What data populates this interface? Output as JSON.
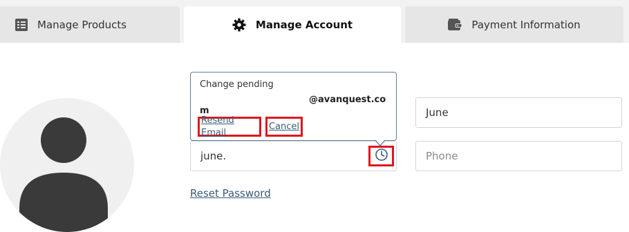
{
  "tabs": [
    {
      "label": "Manage Products",
      "icon": "list-icon",
      "active": false
    },
    {
      "label": "Manage Account",
      "icon": "gear-icon",
      "active": true
    },
    {
      "label": "Payment Information",
      "icon": "wallet-icon",
      "active": false
    }
  ],
  "popup": {
    "title": "Change pending",
    "email_line1": "@avanquest.co",
    "email_line2": "m",
    "resend_label": "Resend Email",
    "cancel_label": "Cancel"
  },
  "form": {
    "email_value": "june.",
    "first_name_value": "June",
    "phone_placeholder": "Phone",
    "reset_password_label": "Reset Password"
  },
  "colors": {
    "accent_link": "#3a5a78",
    "highlight_red": "#e0161c",
    "tab_bg": "#e6e6e6"
  }
}
